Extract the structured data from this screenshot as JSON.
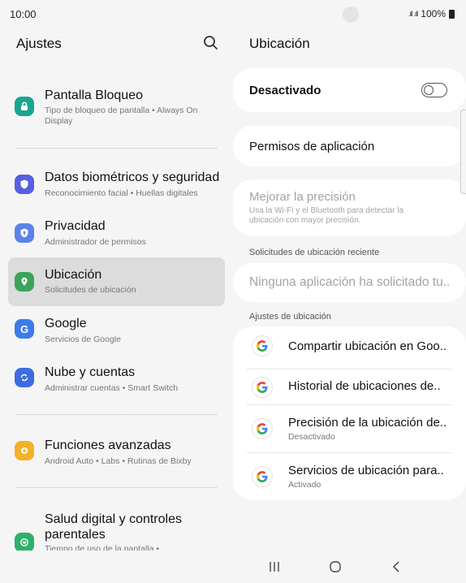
{
  "status_bar": {
    "time": "10:00",
    "signal": ".ıll .ıll",
    "battery": "100%"
  },
  "left_pane": {
    "title": "Ajustes",
    "items": [
      {
        "title": "Pantalla Bloqueo",
        "subtitle": "Tipo de bloqueo de pantalla  •  Always On Display",
        "icon": "lock-icon",
        "color": "#1aa58f"
      },
      {
        "title": "Datos biométricos y seguridad",
        "subtitle": "Reconocimiento facial  •  Huellas digitales",
        "icon": "shield-icon",
        "color": "#5560e0"
      },
      {
        "title": "Privacidad",
        "subtitle": "Administrador de permisos",
        "icon": "privacy-icon",
        "color": "#5a82e8"
      },
      {
        "title": "Ubicación",
        "subtitle": "Solicitudes de ubicación",
        "icon": "location-pin-icon",
        "color": "#3aa55a"
      },
      {
        "title": "Google",
        "subtitle": "Servicios de Google",
        "icon": "google-g-icon",
        "color": "#3d7be8"
      },
      {
        "title": "Nube y cuentas",
        "subtitle": "Administrar cuentas  •  Smart Switch",
        "icon": "sync-icon",
        "color": "#3c6de0"
      },
      {
        "title": "Funciones avanzadas",
        "subtitle": "Android Auto  •  Labs  •  Rutinas de Bixby",
        "icon": "gear-plus-icon",
        "color": "#f3b228"
      },
      {
        "title": "Salud digital y controles parentales",
        "subtitle": "Tiempo de uso de la pantalla  •",
        "icon": "digital-wellbeing-icon",
        "color": "#2fb067"
      }
    ]
  },
  "right_pane": {
    "title": "Ubicación",
    "toggle_label": "Desactivado",
    "toggle_state": "off",
    "app_permissions": "Permisos de aplicación",
    "improve_accuracy": {
      "title": "Mejorar la precisión",
      "description": "Usa la Wi-Fi y el Bluetooth para detectar la ubicación con mayor precisión."
    },
    "recent_requests_label": "Solicitudes de ubicación reciente",
    "no_requests": "Ninguna aplicación ha solicitado tu..",
    "location_settings_label": "Ajustes de ubicación",
    "settings_rows": [
      {
        "title": "Compartir ubicación en Goo..",
        "subtitle": ""
      },
      {
        "title": "Historial de ubicaciones de..",
        "subtitle": ""
      },
      {
        "title": "Precisión de la ubicación de..",
        "subtitle": "Desactivado"
      },
      {
        "title": "Servicios de ubicación para..",
        "subtitle": "Activado"
      }
    ]
  },
  "nav_bar": {
    "recents": "recents-icon",
    "home": "home-icon",
    "back": "back-icon"
  }
}
